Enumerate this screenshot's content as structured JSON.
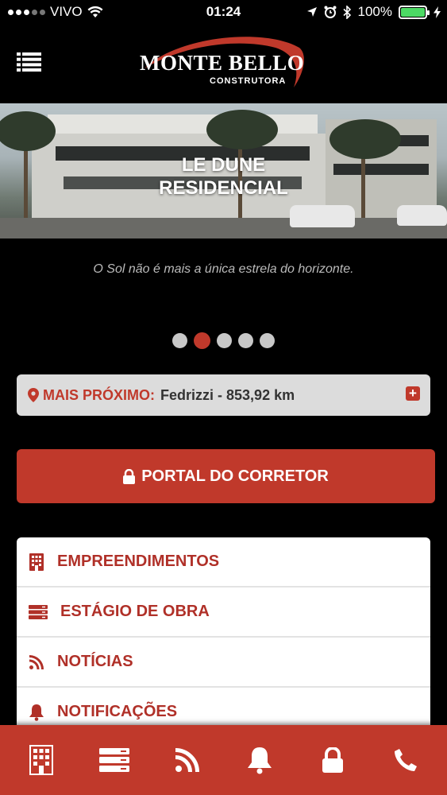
{
  "status_bar": {
    "carrier": "VIVO",
    "time": "01:24",
    "battery": "100%"
  },
  "header": {
    "logo_text": "MONTE BELLO",
    "logo_subtext": "CONSTRUTORA"
  },
  "hero": {
    "title_line1": "LE DUNE",
    "title_line2": "RESIDENCIAL",
    "tagline": "O Sol não é mais a única estrela do horizonte.",
    "slides_count": 5,
    "active_slide": 2
  },
  "nearest": {
    "label": "MAIS PRÓXIMO:",
    "value": "Fedrizzi - 853,92 km"
  },
  "portal_button": {
    "label": "PORTAL DO CORRETOR"
  },
  "menu": [
    {
      "label": "EMPREENDIMENTOS",
      "icon": "building-icon"
    },
    {
      "label": "ESTÁGIO DE OBRA",
      "icon": "server-stack-icon"
    },
    {
      "label": "NOTÍCIAS",
      "icon": "rss-icon"
    },
    {
      "label": "NOTIFICAÇÕES",
      "icon": "bell-icon"
    }
  ],
  "tabbar": [
    "building-icon",
    "server-stack-icon",
    "rss-icon",
    "bell-icon",
    "lock-icon",
    "phone-icon"
  ],
  "colors": {
    "accent": "#c0392b",
    "background": "#000000",
    "nearest_bg": "#dcdcdc"
  }
}
